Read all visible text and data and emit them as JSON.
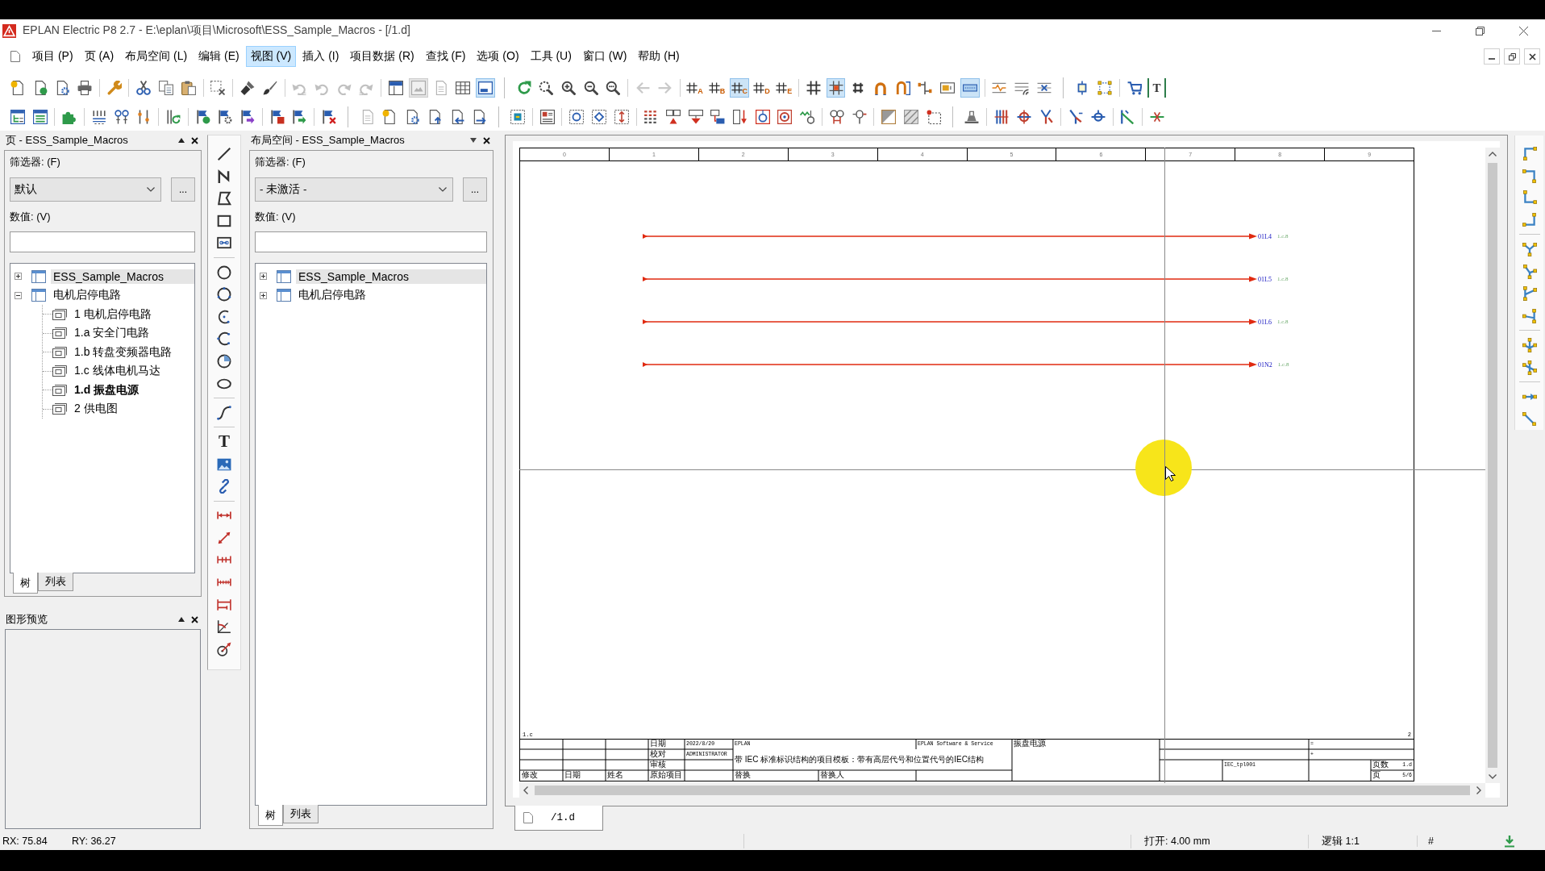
{
  "window": {
    "title": "EPLAN Electric P8 2.7 - E:\\eplan\\项目\\Microsoft\\ESS_Sample_Macros - [/1.d]"
  },
  "menu": [
    {
      "label": "项目 (P)",
      "selected": false
    },
    {
      "label": "页 (A)",
      "selected": false
    },
    {
      "label": "布局空间 (L)",
      "selected": false
    },
    {
      "label": "编辑 (E)",
      "selected": false
    },
    {
      "label": "视图 (V)",
      "selected": true
    },
    {
      "label": "插入 (I)",
      "selected": false
    },
    {
      "label": "项目数据 (R)",
      "selected": false
    },
    {
      "label": "查找 (F)",
      "selected": false
    },
    {
      "label": "选项 (O)",
      "selected": false
    },
    {
      "label": "工具 (U)",
      "selected": false
    },
    {
      "label": "窗口 (W)",
      "selected": false
    },
    {
      "label": "帮助 (H)",
      "selected": false
    }
  ],
  "toolbar_1": [
    [
      [
        {
          "kind": "doc-star",
          "on": false,
          "disabled": false
        },
        {
          "kind": "doc-circle",
          "on": false,
          "disabled": false
        },
        {
          "kind": "doc-gear",
          "on": false,
          "disabled": false
        },
        {
          "kind": "printer",
          "on": false,
          "disabled": false
        }
      ],
      [
        {
          "kind": "wrench",
          "on": false,
          "disabled": false
        }
      ],
      [
        {
          "kind": "scissors",
          "on": false,
          "disabled": false
        },
        {
          "kind": "copy",
          "on": false,
          "disabled": false
        },
        {
          "kind": "paste",
          "on": false,
          "disabled": false
        }
      ],
      [
        {
          "kind": "select-delete",
          "on": false,
          "disabled": false
        }
      ],
      [
        {
          "kind": "brush",
          "on": false,
          "disabled": false
        },
        {
          "kind": "brush-angled",
          "on": false,
          "disabled": false
        }
      ],
      [
        {
          "kind": "undo-list",
          "on": false,
          "disabled": true
        },
        {
          "kind": "undo",
          "on": false,
          "disabled": true
        },
        {
          "kind": "redo",
          "on": false,
          "disabled": true
        },
        {
          "kind": "redo-list",
          "on": false,
          "disabled": true
        }
      ],
      [
        {
          "kind": "layout",
          "on": false,
          "disabled": false
        },
        {
          "kind": "preview-window",
          "on": true,
          "disabled": true
        },
        {
          "kind": "doc-check",
          "on": false,
          "disabled": true
        },
        {
          "kind": "table",
          "on": false,
          "disabled": false
        },
        {
          "kind": "screen",
          "on": true,
          "disabled": false
        }
      ]
    ],
    [
      [
        {
          "kind": "refresh",
          "on": false,
          "disabled": false
        },
        {
          "kind": "zoom-window",
          "on": false,
          "disabled": false
        },
        {
          "kind": "zoom-in",
          "on": false,
          "disabled": false
        },
        {
          "kind": "zoom-out",
          "on": false,
          "disabled": false
        },
        {
          "kind": "zoom-fit",
          "on": false,
          "disabled": false
        }
      ],
      [
        {
          "kind": "arrow-left",
          "on": false,
          "disabled": true
        },
        {
          "kind": "arrow-right",
          "on": false,
          "disabled": true
        }
      ],
      [
        {
          "kind": "grid-letter",
          "label": "A",
          "on": false,
          "disabled": false
        },
        {
          "kind": "grid-letter",
          "label": "B",
          "on": false,
          "disabled": false
        },
        {
          "kind": "grid-letter",
          "label": "C",
          "on": true,
          "disabled": false
        },
        {
          "kind": "grid-letter",
          "label": "D",
          "on": false,
          "disabled": false
        },
        {
          "kind": "grid-letter",
          "label": "E",
          "on": false,
          "disabled": false
        }
      ],
      [
        {
          "kind": "grid",
          "on": false,
          "disabled": false
        },
        {
          "kind": "snap-grid",
          "on": true,
          "disabled": false
        },
        {
          "kind": "small-hash",
          "on": false,
          "disabled": false
        },
        {
          "kind": "magnet",
          "on": false,
          "disabled": false
        },
        {
          "kind": "magnet-frame",
          "on": false,
          "disabled": false
        },
        {
          "kind": "branch",
          "on": false,
          "disabled": false
        },
        {
          "kind": "numbered-box",
          "on": false,
          "disabled": false
        },
        {
          "kind": "bar",
          "on": true,
          "disabled": false
        }
      ],
      [
        {
          "kind": "wave-lines",
          "on": false,
          "disabled": false
        },
        {
          "kind": "signal-lines",
          "on": false,
          "disabled": false
        },
        {
          "kind": "cross-lines",
          "on": false,
          "disabled": false
        }
      ]
    ],
    [
      [
        {
          "kind": "small-square",
          "on": false,
          "disabled": false
        },
        {
          "kind": "resize-frame",
          "on": false,
          "disabled": false
        }
      ],
      [
        {
          "kind": "cart",
          "on": false,
          "disabled": false
        },
        {
          "kind": "text-frame",
          "label": "T",
          "on": false,
          "disabled": false
        }
      ]
    ]
  ],
  "toolbar_2": [
    [
      [
        {
          "kind": "page-tree",
          "on": false,
          "disabled": false
        },
        {
          "kind": "page-list",
          "on": false,
          "disabled": false
        }
      ],
      [
        {
          "kind": "puzzle",
          "on": false,
          "disabled": false
        }
      ],
      [
        {
          "kind": "numbering",
          "on": false,
          "disabled": false
        },
        {
          "kind": "terminal-numbering",
          "on": false,
          "disabled": false
        },
        {
          "kind": "vertical-numbering",
          "on": false,
          "disabled": false
        }
      ],
      [
        {
          "kind": "bars-refresh",
          "on": false,
          "disabled": false
        }
      ],
      [
        {
          "kind": "flag-check",
          "on": false,
          "disabled": false
        },
        {
          "kind": "flag-gear",
          "on": false,
          "disabled": false
        },
        {
          "kind": "flag-arrow",
          "on": false,
          "disabled": false
        }
      ],
      [
        {
          "kind": "flag-doc",
          "on": false,
          "disabled": false
        },
        {
          "kind": "flag-green-arrow",
          "on": false,
          "disabled": false
        }
      ],
      [
        {
          "kind": "flag-cross",
          "on": false,
          "disabled": false
        }
      ]
    ],
    [
      [
        {
          "kind": "doc-plain",
          "on": false,
          "disabled": true
        },
        {
          "kind": "doc-star",
          "on": false,
          "disabled": false
        },
        {
          "kind": "doc-gear",
          "on": false,
          "disabled": false
        },
        {
          "kind": "doc-up",
          "on": false,
          "disabled": false
        },
        {
          "kind": "doc-left",
          "on": false,
          "disabled": false
        },
        {
          "kind": "doc-right",
          "on": false,
          "disabled": false
        }
      ]
    ],
    [
      [
        {
          "kind": "macro",
          "on": false,
          "disabled": false
        }
      ],
      [
        {
          "kind": "placeholder",
          "on": false,
          "disabled": false
        }
      ],
      [
        {
          "kind": "box-circle",
          "on": false,
          "disabled": false
        },
        {
          "kind": "box-diamond",
          "on": false,
          "disabled": false
        },
        {
          "kind": "box-arrows",
          "on": false,
          "disabled": false
        }
      ],
      [
        {
          "kind": "dot-grid",
          "on": false,
          "disabled": false
        },
        {
          "kind": "red-flow",
          "on": false,
          "disabled": false
        },
        {
          "kind": "device-tee",
          "on": false,
          "disabled": false
        },
        {
          "kind": "device-stack",
          "on": false,
          "disabled": false
        },
        {
          "kind": "device-sort",
          "on": false,
          "disabled": false
        },
        {
          "kind": "ring-box",
          "on": false,
          "disabled": false
        },
        {
          "kind": "ring-red",
          "on": false,
          "disabled": false
        },
        {
          "kind": "wave-device",
          "on": false,
          "disabled": false
        }
      ],
      [
        {
          "kind": "connector-pair",
          "on": false,
          "disabled": false
        },
        {
          "kind": "connector-arrow",
          "on": false,
          "disabled": false
        }
      ],
      [
        {
          "kind": "corner-fill",
          "on": false,
          "disabled": false
        },
        {
          "kind": "hatch",
          "on": false,
          "disabled": false
        },
        {
          "kind": "dashed-frame",
          "on": false,
          "disabled": false
        }
      ]
    ],
    [
      [
        {
          "kind": "tray",
          "on": false,
          "disabled": false
        }
      ],
      [
        {
          "kind": "vertical-lines",
          "on": false,
          "disabled": false
        },
        {
          "kind": "circle-cross",
          "on": false,
          "disabled": false
        },
        {
          "kind": "red-branch",
          "on": false,
          "disabled": false
        }
      ],
      [
        {
          "kind": "blue-branch",
          "on": false,
          "disabled": false
        },
        {
          "kind": "circle-line",
          "on": false,
          "disabled": false
        }
      ],
      [
        {
          "kind": "angle-line",
          "on": false,
          "disabled": false
        }
      ],
      [
        {
          "kind": "jumper",
          "on": false,
          "disabled": false
        }
      ]
    ]
  ],
  "pages_panel": {
    "title": "页 - ESS_Sample_Macros",
    "filter_label": "筛选器: (F)",
    "filter_value": "默认",
    "more_button": "...",
    "value_label": "数值: (V)",
    "tree": [
      {
        "label": "ESS_Sample_Macros",
        "selected": true,
        "expanded": false
      },
      {
        "label": "电机启停电路",
        "selected": false,
        "expanded": true,
        "children": [
          {
            "label": "1 电机启停电路",
            "selected": false,
            "current": false
          },
          {
            "label": "1.a 安全门电路",
            "selected": false,
            "current": false
          },
          {
            "label": "1.b 转盘变频器电路",
            "selected": false,
            "current": false
          },
          {
            "label": "1.c 线体电机马达",
            "selected": false,
            "current": false
          },
          {
            "label": "1.d 振盘电源",
            "selected": false,
            "current": true
          },
          {
            "label": "2 供电图",
            "selected": false,
            "current": false
          }
        ]
      }
    ],
    "tabs": [
      {
        "label": "树",
        "selected": true
      },
      {
        "label": "列表",
        "selected": false
      }
    ]
  },
  "preview_panel": {
    "title": "图形预览"
  },
  "draw_toolbar": [
    [
      {
        "kind": "line"
      },
      {
        "kind": "polyline"
      },
      {
        "kind": "polygon"
      },
      {
        "kind": "rect"
      },
      {
        "kind": "conn-rect"
      }
    ],
    [
      {
        "kind": "circle"
      },
      {
        "kind": "circle-points"
      },
      {
        "kind": "arc"
      },
      {
        "kind": "arc-points"
      },
      {
        "kind": "pie"
      },
      {
        "kind": "ellipse"
      }
    ],
    [
      {
        "kind": "spline"
      }
    ],
    [
      {
        "kind": "text",
        "label": "T"
      },
      {
        "kind": "image"
      },
      {
        "kind": "link"
      }
    ],
    [
      {
        "kind": "dim-h"
      },
      {
        "kind": "dim-diag"
      },
      {
        "kind": "dim-chain"
      },
      {
        "kind": "dim-steps"
      },
      {
        "kind": "dim-base"
      },
      {
        "kind": "dim-angle"
      },
      {
        "kind": "dim-radius"
      }
    ]
  ],
  "layout_panel": {
    "title": "布局空间 - ESS_Sample_Macros",
    "filter_label": "筛选器: (F)",
    "filter_value": "- 未激活 -",
    "more_button": "...",
    "value_label": "数值: (V)",
    "tree": [
      {
        "label": "ESS_Sample_Macros",
        "selected": true,
        "expanded": false
      },
      {
        "label": "电机启停电路",
        "selected": false,
        "expanded": false
      }
    ],
    "tabs": [
      {
        "label": "树",
        "selected": true
      },
      {
        "label": "列表",
        "selected": false
      }
    ]
  },
  "editor": {
    "columns": [
      "0",
      "1",
      "2",
      "3",
      "4",
      "5",
      "6",
      "7",
      "8",
      "9"
    ],
    "wires": [
      {
        "label": "01L4",
        "reference": "1.c.8"
      },
      {
        "label": "01L5",
        "reference": "1.c.8"
      },
      {
        "label": "01L6",
        "reference": "1.c.8"
      },
      {
        "label": "01N2",
        "reference": "1.c.8"
      }
    ],
    "previous_page": "1.c",
    "next_page": "2",
    "title_block": {
      "date_label": "日期",
      "date": "2022/8/20",
      "checked_label": "校对",
      "checked_by": "ADMINISTRATOR",
      "approved_label": "审核",
      "revision_labels": [
        "修改",
        "日期",
        "姓名"
      ],
      "original_label": "原始项目",
      "company": "EPLAN",
      "maker": "EPLAN Software & Service",
      "description": "带 IEC 标准标识结构的项目模板：带有高层代号和位置代号的IEC结构",
      "replacement_label": "替换",
      "replaced_by_label": "替换人",
      "page_description": "振盘电源",
      "higher_level": "=",
      "location": "+",
      "template": "IEC_tpl001",
      "page_label": "页数",
      "page": "1.d",
      "sheet_label": "页",
      "sheet": "5/6"
    },
    "tabs": [
      {
        "label": "/1.d",
        "selected": true
      }
    ]
  },
  "connection_toolbar": [
    [
      {
        "kind": "corner-tl"
      },
      {
        "kind": "corner-tr"
      },
      {
        "kind": "corner-bl"
      },
      {
        "kind": "corner-br"
      }
    ],
    [
      {
        "kind": "tee-down"
      },
      {
        "kind": "tee-up"
      },
      {
        "kind": "tee-left"
      },
      {
        "kind": "tee-right"
      }
    ],
    [
      {
        "kind": "cross-a"
      },
      {
        "kind": "cross-b"
      }
    ],
    [
      {
        "kind": "interrupt"
      },
      {
        "kind": "diagonal"
      }
    ]
  ],
  "status_bar": {
    "rx": "RX: 75.84",
    "ry": "RY: 36.27",
    "grid": "打开: 4.00 mm",
    "scale": "逻辑 1:1",
    "mode": "#"
  }
}
